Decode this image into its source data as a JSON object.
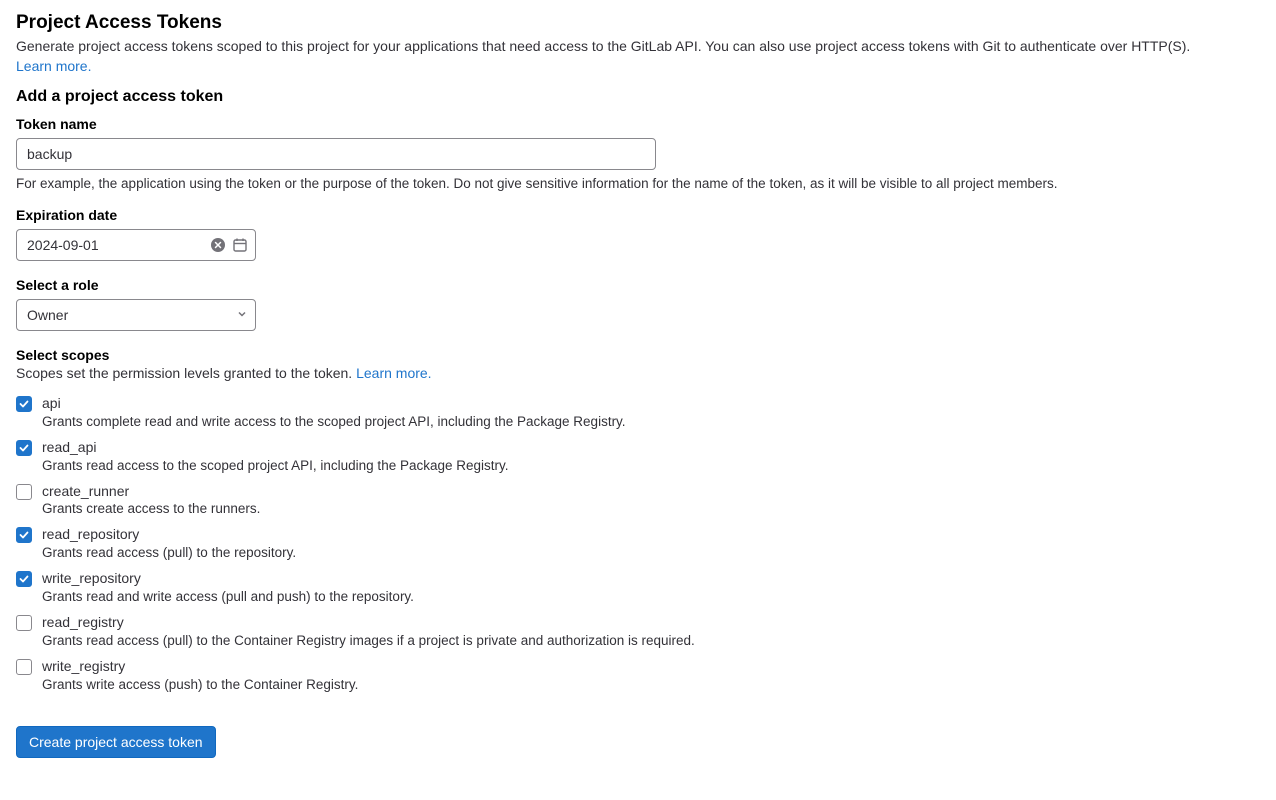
{
  "header": {
    "title": "Project Access Tokens",
    "description": "Generate project access tokens scoped to this project for your applications that need access to the GitLab API. You can also use project access tokens with Git to authenticate over HTTP(S).",
    "learn_more": "Learn more."
  },
  "form": {
    "section_title": "Add a project access token",
    "token_name": {
      "label": "Token name",
      "value": "backup",
      "help": "For example, the application using the token or the purpose of the token. Do not give sensitive information for the name of the token, as it will be visible to all project members."
    },
    "expiration": {
      "label": "Expiration date",
      "value": "2024-09-01"
    },
    "role": {
      "label": "Select a role",
      "selected": "Owner"
    },
    "scopes_section": {
      "heading": "Select scopes",
      "description": "Scopes set the permission levels granted to the token. ",
      "learn_more": "Learn more."
    },
    "scopes": [
      {
        "name": "api",
        "desc": "Grants complete read and write access to the scoped project API, including the Package Registry.",
        "checked": true
      },
      {
        "name": "read_api",
        "desc": "Grants read access to the scoped project API, including the Package Registry.",
        "checked": true
      },
      {
        "name": "create_runner",
        "desc": "Grants create access to the runners.",
        "checked": false
      },
      {
        "name": "read_repository",
        "desc": "Grants read access (pull) to the repository.",
        "checked": true
      },
      {
        "name": "write_repository",
        "desc": "Grants read and write access (pull and push) to the repository.",
        "checked": true
      },
      {
        "name": "read_registry",
        "desc": "Grants read access (pull) to the Container Registry images if a project is private and authorization is required.",
        "checked": false
      },
      {
        "name": "write_registry",
        "desc": "Grants write access (push) to the Container Registry.",
        "checked": false
      }
    ],
    "submit_label": "Create project access token"
  }
}
